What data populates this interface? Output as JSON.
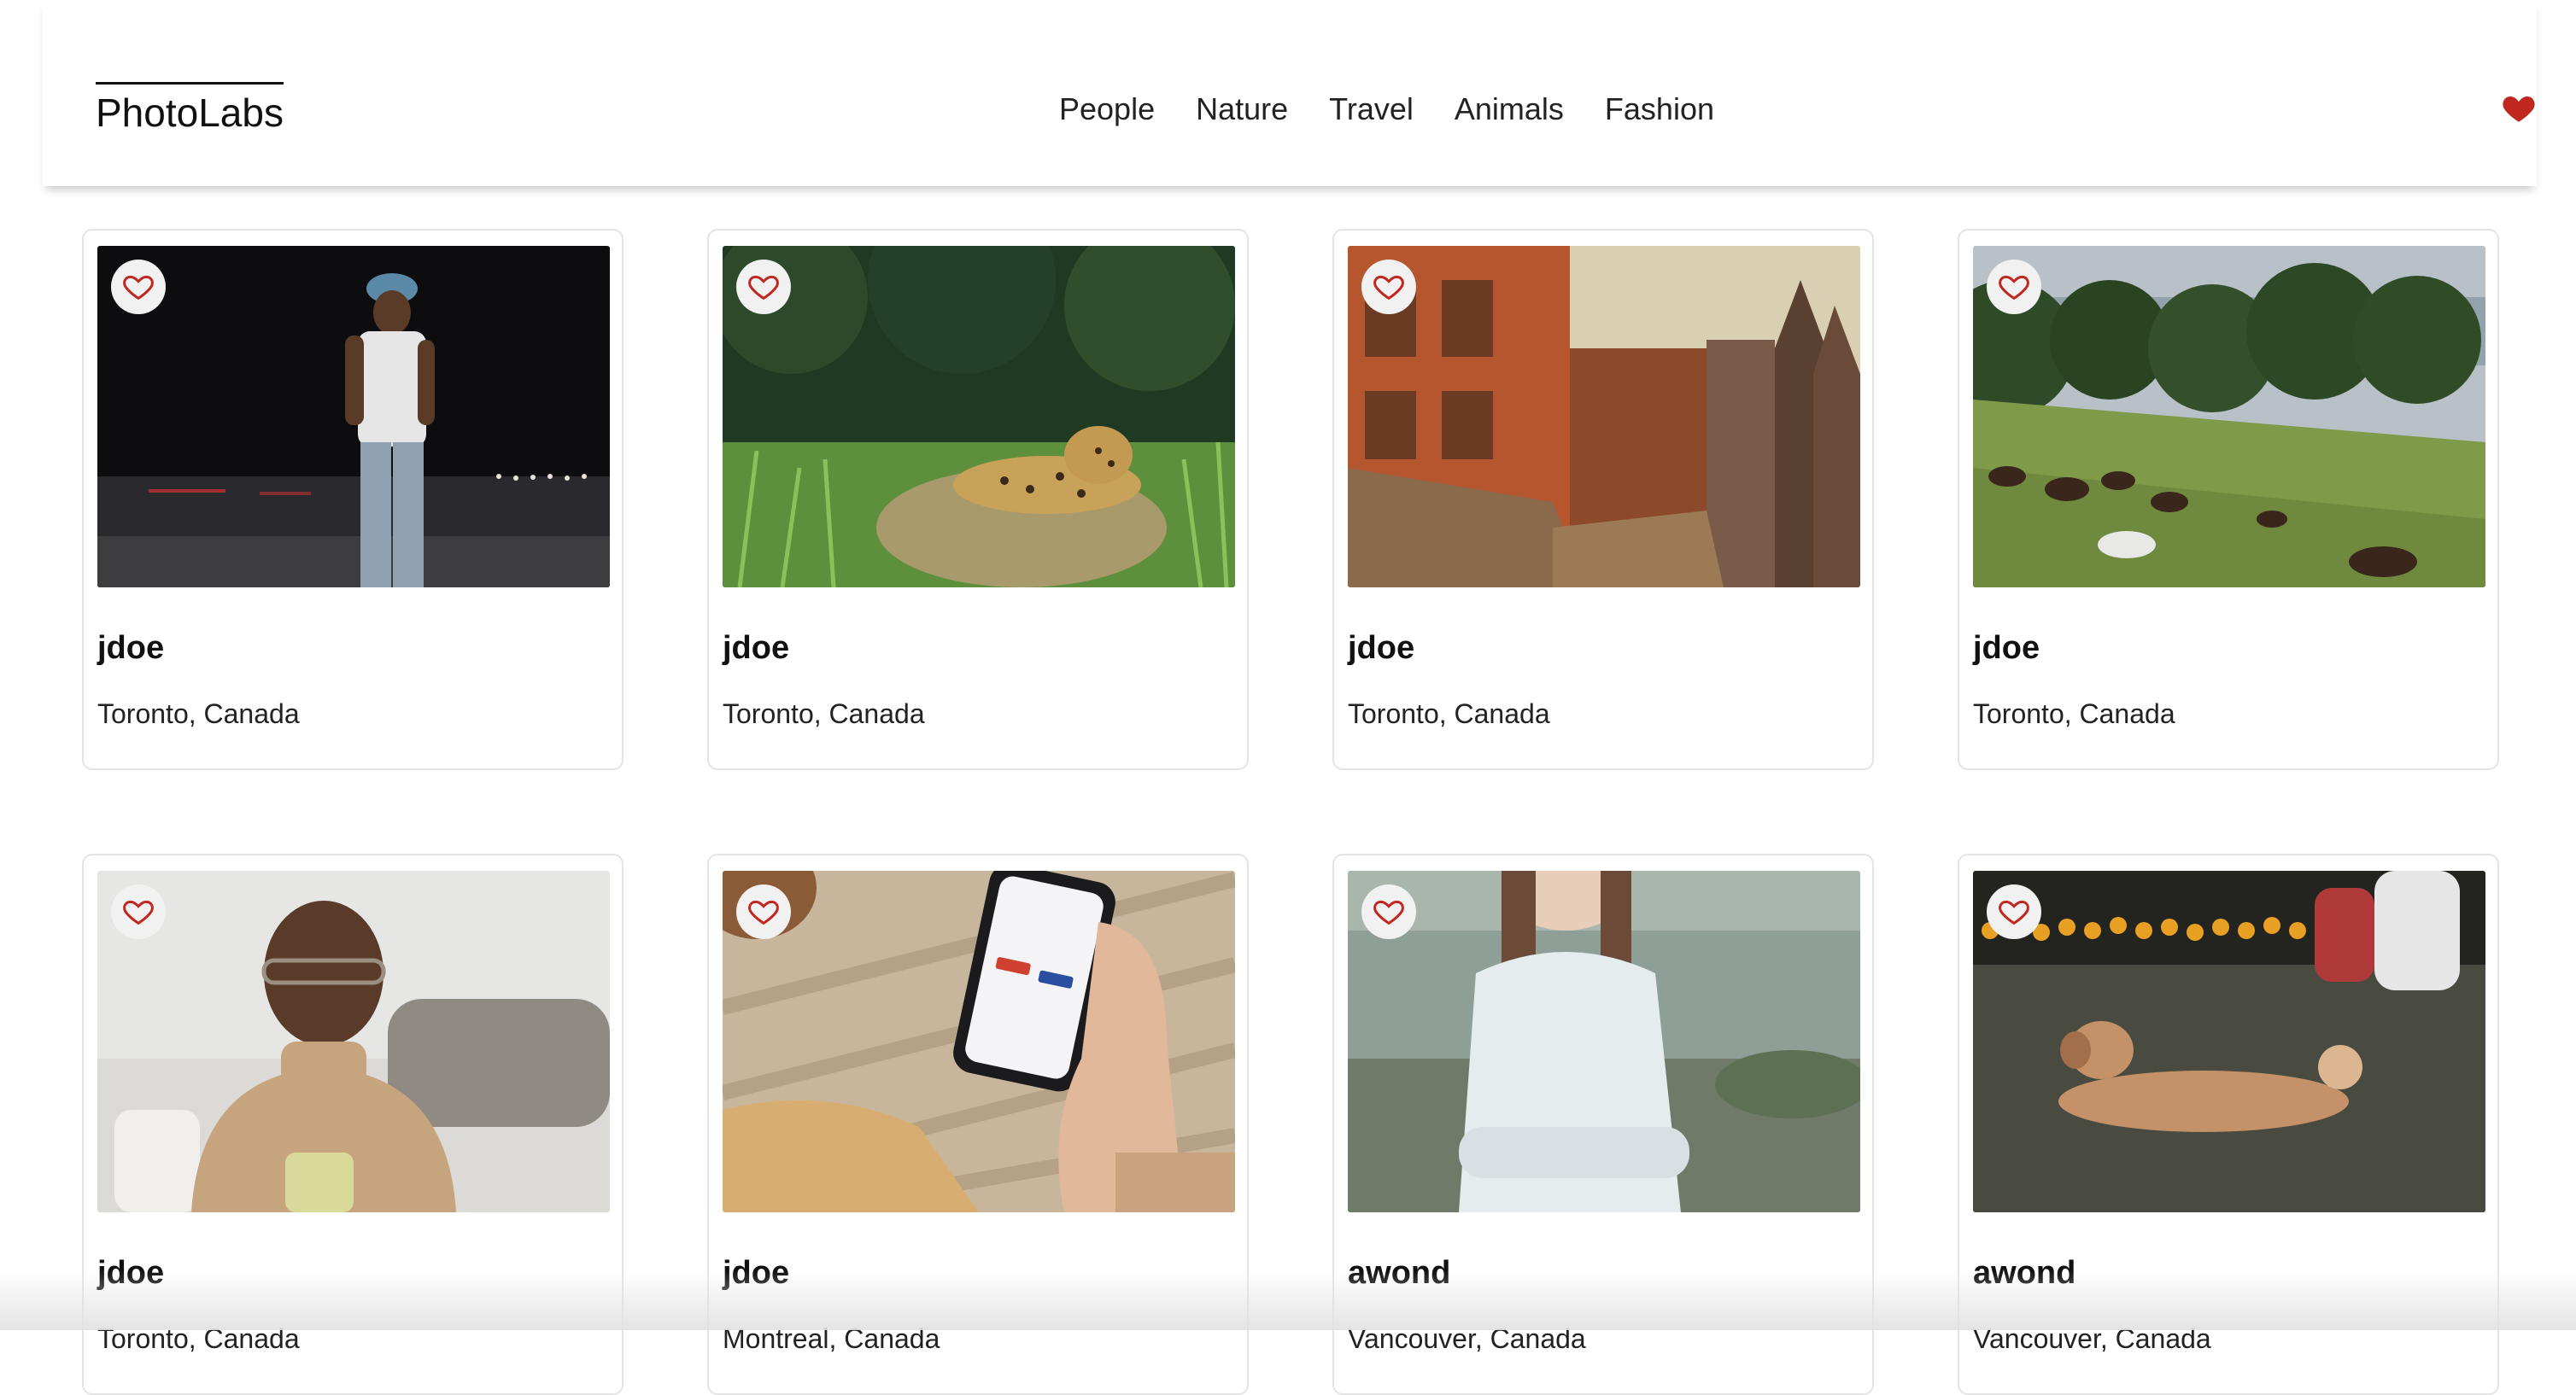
{
  "app": {
    "logo": "PhotoLabs"
  },
  "nav": {
    "topics": [
      "People",
      "Nature",
      "Travel",
      "Animals",
      "Fashion"
    ],
    "favorites_indicator": {
      "icon": "heart-filled-icon",
      "color": "#c0281f"
    }
  },
  "photos": [
    {
      "username": "jdoe",
      "location": "Toronto, Canada",
      "subject": "man-walking-at-night",
      "fav_icon": "heart-outline-icon"
    },
    {
      "username": "jdoe",
      "location": "Toronto, Canada",
      "subject": "leopard-in-grass",
      "fav_icon": "heart-outline-icon"
    },
    {
      "username": "jdoe",
      "location": "Toronto, Canada",
      "subject": "old-city-buildings",
      "fav_icon": "heart-outline-icon"
    },
    {
      "username": "jdoe",
      "location": "Toronto, Canada",
      "subject": "horses-grazing-hillside",
      "fav_icon": "heart-outline-icon"
    },
    {
      "username": "jdoe",
      "location": "Toronto, Canada",
      "subject": "smiling-man-with-mug",
      "fav_icon": "heart-outline-icon"
    },
    {
      "username": "jdoe",
      "location": "Montreal, Canada",
      "subject": "hand-holding-phone",
      "fav_icon": "heart-outline-icon"
    },
    {
      "username": "awond",
      "location": "Vancouver, Canada",
      "subject": "woman-by-water",
      "fav_icon": "heart-outline-icon"
    },
    {
      "username": "awond",
      "location": "Vancouver, Canada",
      "subject": "dog-lying-on-grass",
      "fav_icon": "heart-outline-icon"
    }
  ],
  "colors": {
    "accent": "#c0281f",
    "border": "#e4e4e4",
    "text": "#111111"
  }
}
